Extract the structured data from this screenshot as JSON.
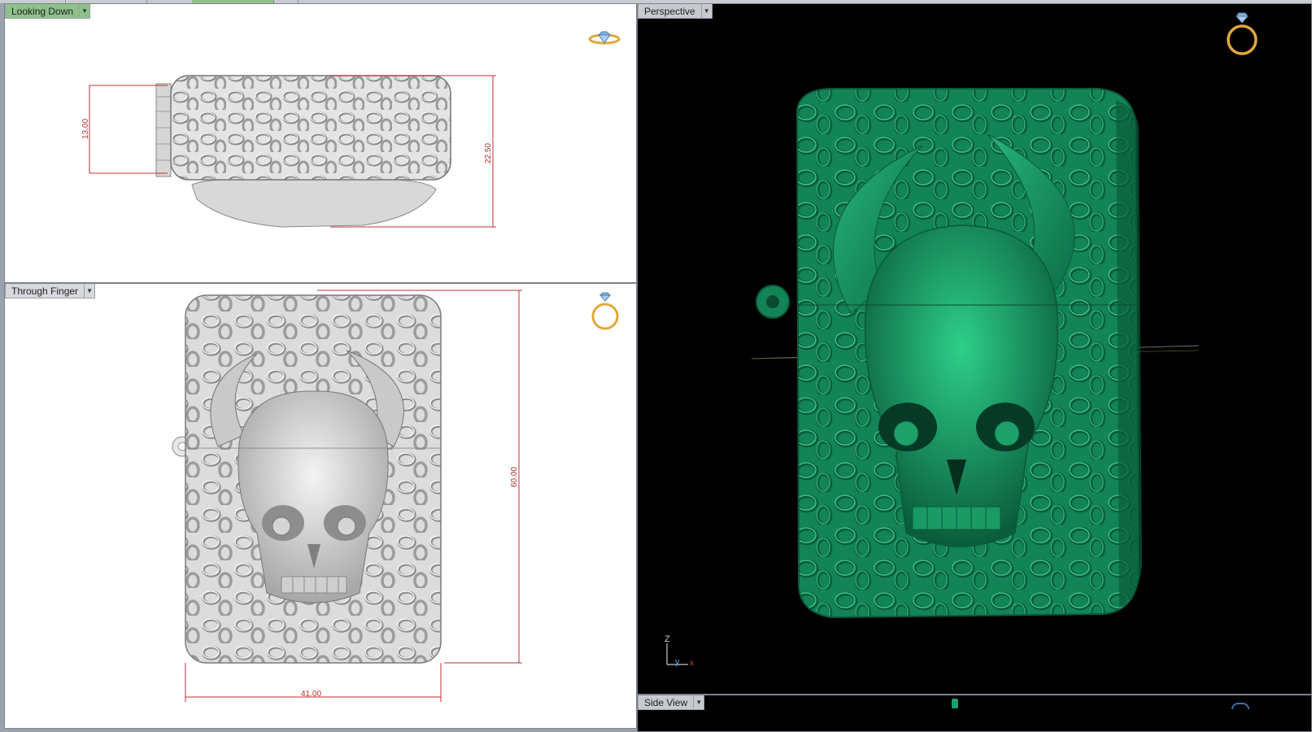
{
  "viewports": {
    "top": {
      "label": "Looking Down",
      "dim_height": "13.00",
      "dim_depth": "22.50"
    },
    "front": {
      "label": "Through Finger",
      "dim_height": "60.00",
      "dim_width": "41.00"
    },
    "perspective": {
      "label": "Perspective"
    },
    "side": {
      "label": "Side View"
    }
  },
  "axis": {
    "z": "Z",
    "y": "y",
    "x": "x"
  },
  "icons": {
    "top_badge": "diamond-ring-flat-icon",
    "front_badge": "ring-icon",
    "perspective_badge": "ring-icon",
    "dropdown": "chevron-down-icon"
  },
  "colors": {
    "active_label": "#8fc08a",
    "model_green": "#148a5a",
    "model_white": "#e2e2e2",
    "dimension_red": "#c03030",
    "gold": "#e0a93a"
  }
}
